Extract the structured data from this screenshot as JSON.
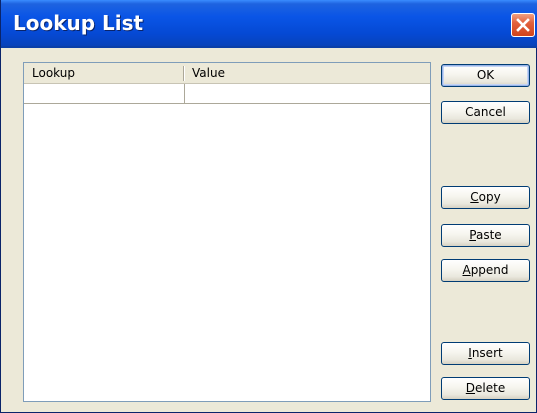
{
  "window": {
    "title": "Lookup List"
  },
  "list": {
    "columns": [
      "Lookup",
      "Value"
    ],
    "rows": [
      {
        "lookup": "",
        "value": ""
      }
    ]
  },
  "buttons": {
    "ok": {
      "accel": "",
      "rest": "OK"
    },
    "cancel": {
      "accel": "",
      "rest": "Cancel"
    },
    "copy": {
      "accel": "C",
      "rest": "opy"
    },
    "paste": {
      "accel": "P",
      "rest": "aste"
    },
    "append": {
      "accel": "A",
      "rest": "ppend"
    },
    "insert": {
      "accel": "I",
      "rest": "nsert"
    },
    "delete": {
      "accel": "D",
      "rest": "elete"
    }
  },
  "colors": {
    "titlebar": "#0549d4",
    "close_button": "#d0431c",
    "dialog_face": "#ece9d8",
    "list_border": "#7f9db9",
    "button_border": "#003c74"
  },
  "icons": {
    "close": "close-icon"
  }
}
